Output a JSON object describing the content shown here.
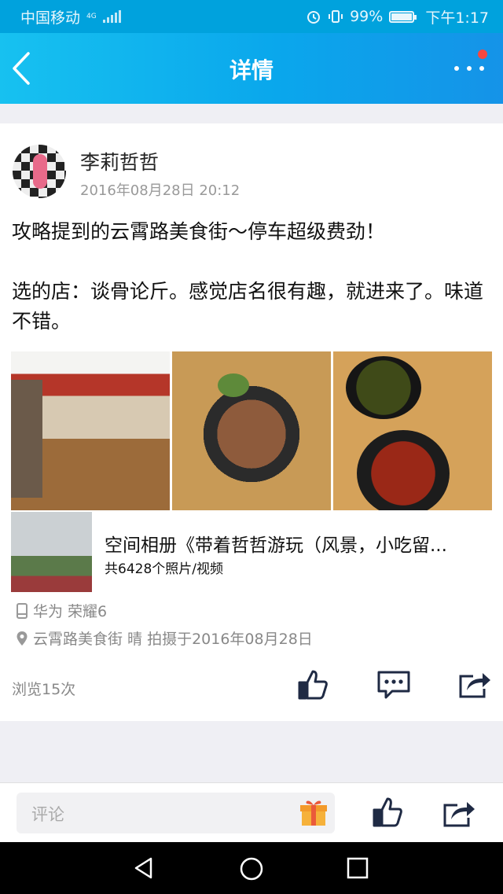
{
  "status_bar": {
    "carrier": "中国移动",
    "network": "4G",
    "battery": "99%",
    "time": "下午1:17",
    "icons": [
      "signal-icon",
      "alarm-icon",
      "vibrate-icon",
      "battery-icon"
    ]
  },
  "nav": {
    "title": "详情",
    "back_icon": "chevron-left-icon",
    "more_icon": "more-dots-icon",
    "has_notification_dot": true
  },
  "post": {
    "author": "李莉哲哲",
    "time": "2016年08月28日 20:12",
    "text": "攻略提到的云霄路美食街～停车超级费劲！\n\n选的店：谈骨论斤。感觉店名很有趣，就进来了。味道不错。",
    "photos": [
      "restaurant-interior",
      "stewed-meat-dish",
      "dipping-sauces"
    ],
    "album": {
      "title": "空间相册《带着哲哲游玩（风景，小吃留...",
      "count": "共6428个照片/视频"
    },
    "device": "华为 荣耀6",
    "location": "云霄路美食街 晴 拍摄于2016年08月28日",
    "views": "浏览15次"
  },
  "comment_bar": {
    "placeholder": "评论"
  },
  "colors": {
    "status_bar": "#00a2dd",
    "nav_gradient_start": "#17c1f0",
    "nav_gradient_end": "#1593e8",
    "icon_dark": "#1f2a44",
    "notification_dot": "#f7473f",
    "page_bg": "#efeff4"
  }
}
